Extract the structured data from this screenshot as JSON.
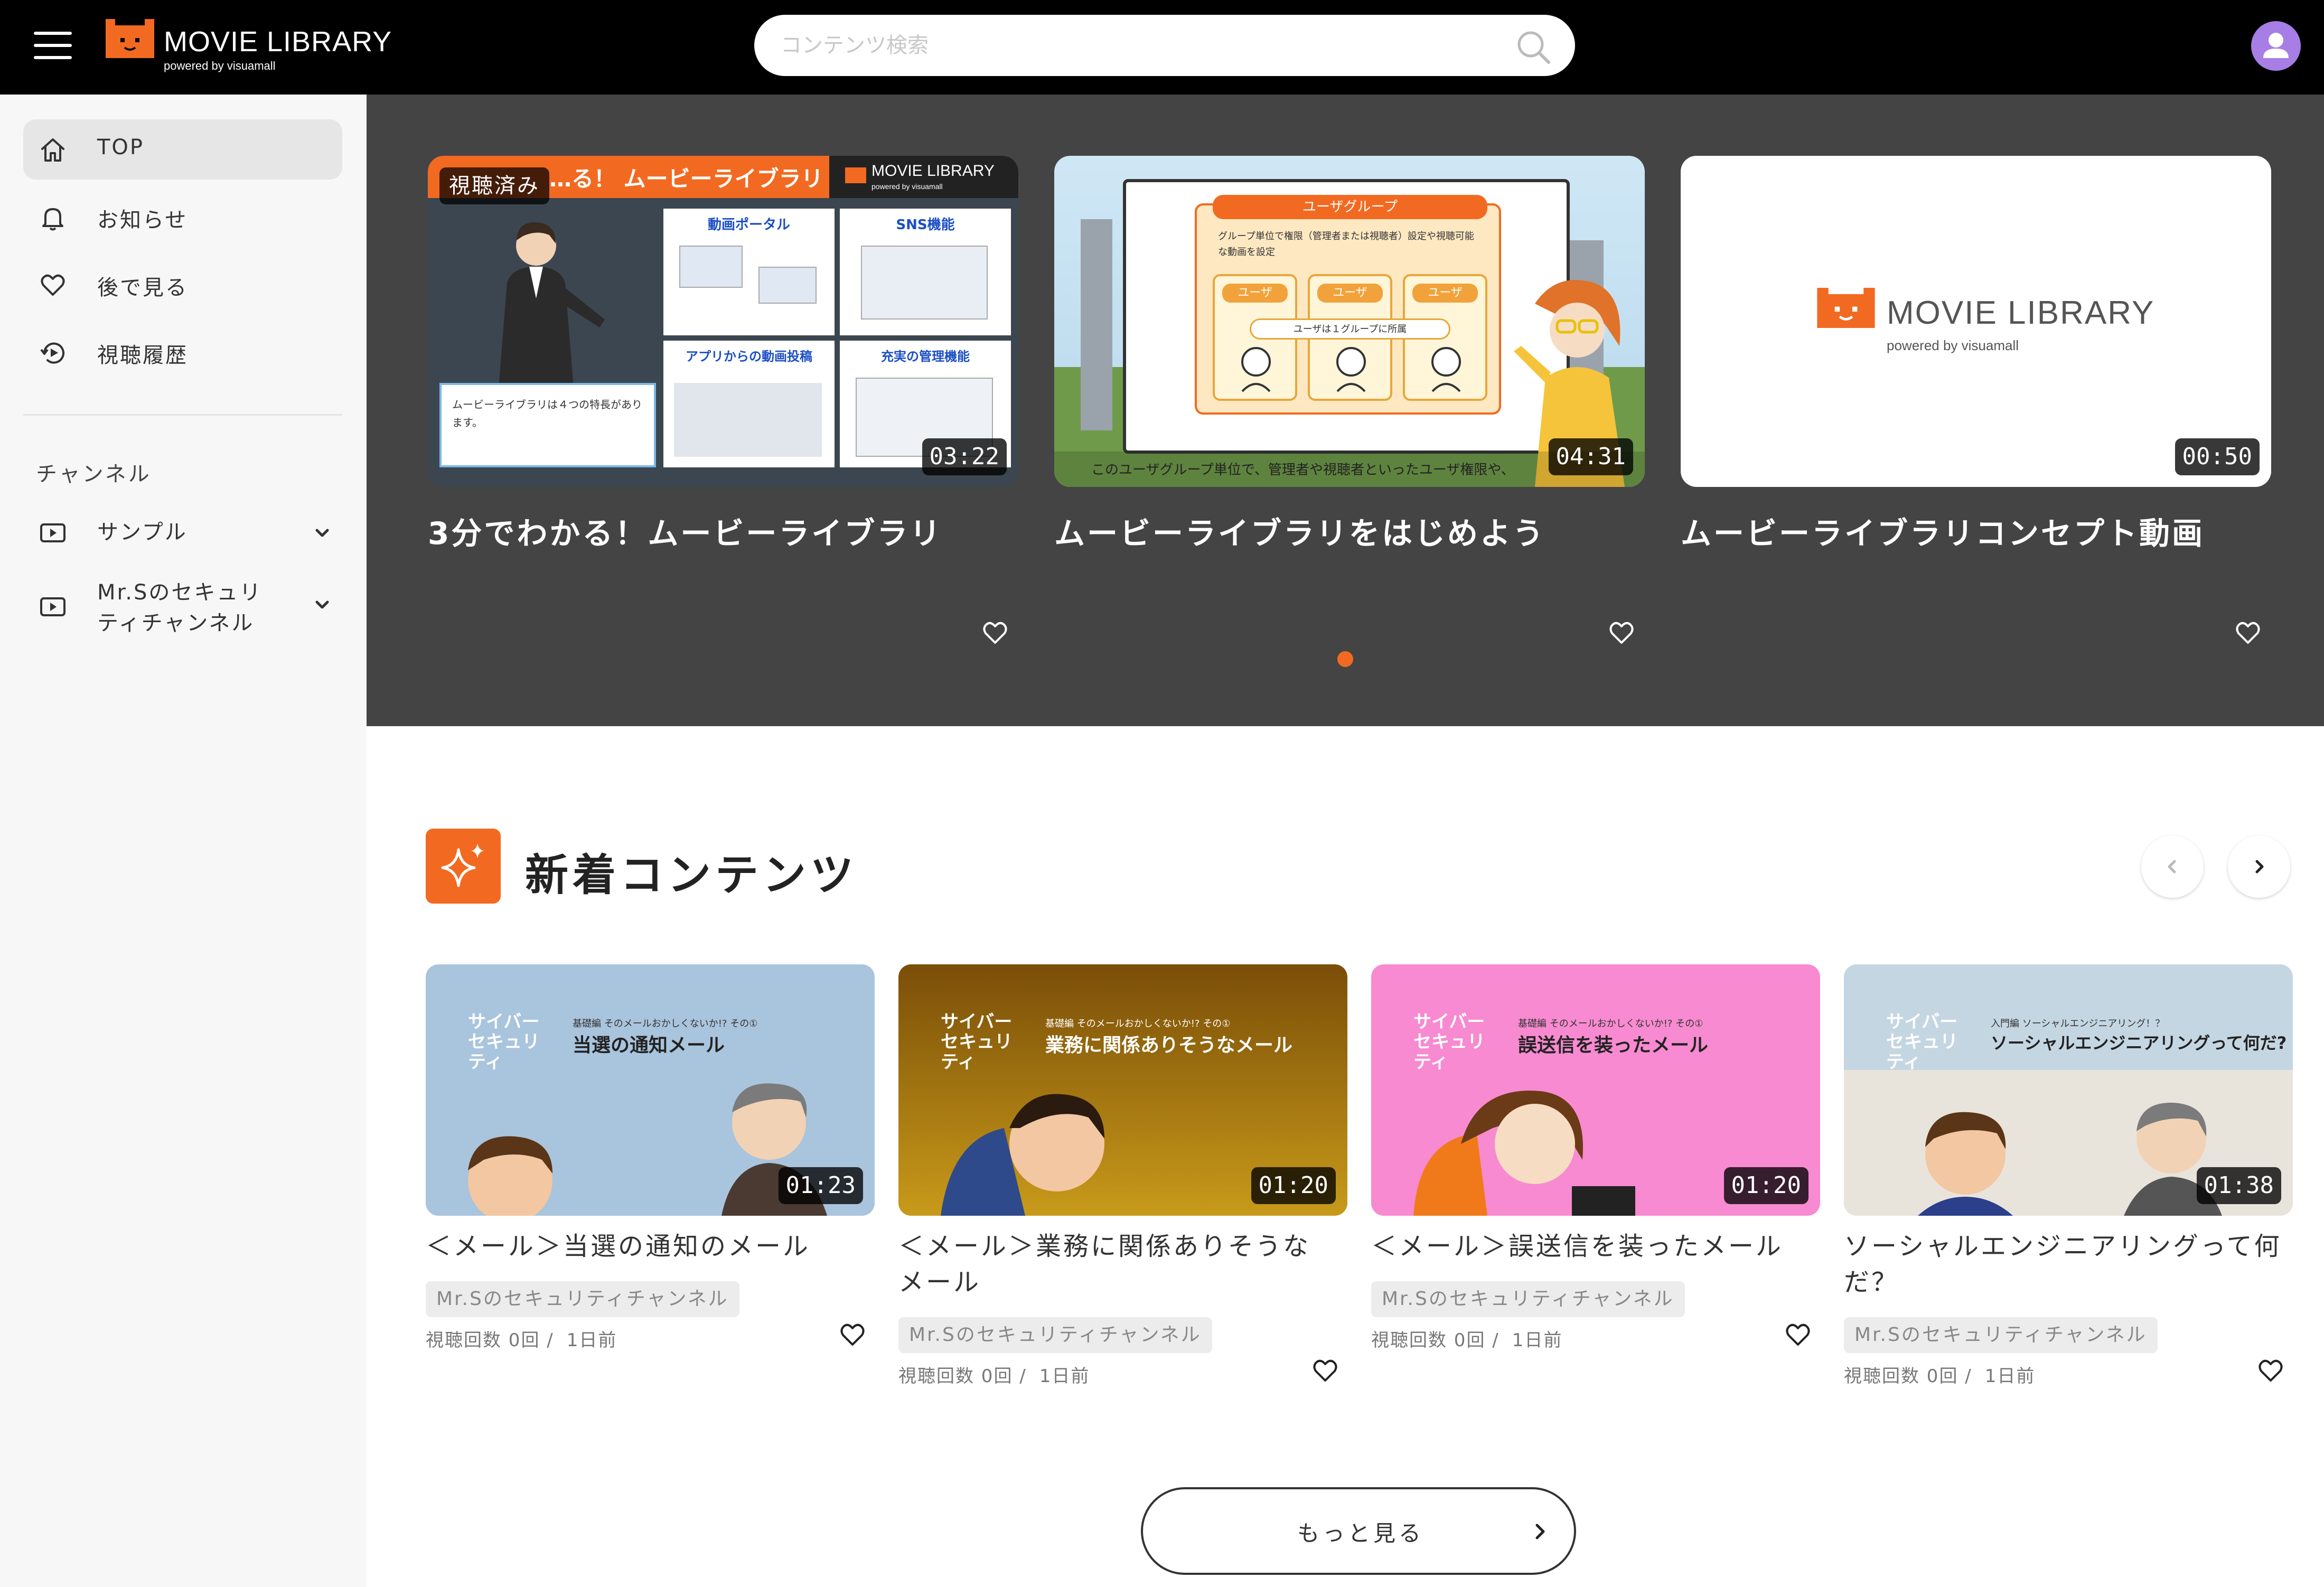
{
  "header": {
    "logo_title": "MOVIE LIBRARY",
    "logo_sub": "powered by visuamall",
    "search_placeholder": "コンテンツ検索"
  },
  "colors": {
    "accent": "#f26a21",
    "avatar": "#a77de6",
    "header_bg": "#000000",
    "hero_bg": "#444444"
  },
  "sidebar": {
    "nav": [
      {
        "label": "TOP",
        "icon": "home-icon",
        "active": true
      },
      {
        "label": "お知らせ",
        "icon": "bell-icon",
        "active": false
      },
      {
        "label": "後で見る",
        "icon": "heart-icon",
        "active": false
      },
      {
        "label": "視聴履歴",
        "icon": "history-icon",
        "active": false
      }
    ],
    "channels_title": "チャンネル",
    "channels": [
      {
        "label": "サンプル",
        "icon": "play-icon"
      },
      {
        "label": "Mr.Sのセキュリティチャンネル",
        "icon": "play-icon"
      }
    ]
  },
  "carousel": {
    "items": [
      {
        "title": "3分でわかる！ムービーライブラリ",
        "duration": "03:22",
        "badge": "視聴済み",
        "thumb_banner": "…る！ ムービーライブラリ",
        "thumb_logo": "MOVIE LIBRARY",
        "thumb_logo_sub": "powered by visuamall",
        "thumb_panels": [
          "動画ポータル",
          "SNS機能",
          "アプリからの動画投稿",
          "充実の管理機能"
        ],
        "thumb_caption": "ムービーライブラリは４つの特長があります。"
      },
      {
        "title": "ムービーライブラリをはじめよう",
        "duration": "04:31",
        "thumb_group": "ユーザグループ",
        "thumb_desc": "グループ単位で権限（管理者または視聴者）設定や視聴可能な動画を設定",
        "thumb_user": "ユーザ",
        "thumb_belong": "ユーザは１グループに所属",
        "thumb_caption": "このユーザグループ単位で、管理者や視聴者といったユーザ権限や、"
      },
      {
        "title": "ムービーライブラリコンセプト動画",
        "duration": "00:50",
        "thumb_logo": "MOVIE LIBRARY",
        "thumb_logo_sub": "powered by visuamall"
      }
    ]
  },
  "new_contents": {
    "heading": "新着コンテンツ",
    "items": [
      {
        "title": "＜メール＞当選の通知のメール",
        "duration": "01:23",
        "channel": "Mr.Sのセキュリティチャンネル",
        "views": "視聴回数 0回 /",
        "age": "1日前",
        "thumb_brand": "サイバー セキュリティ",
        "thumb_series": "基礎編 そのメールおかしくないか!? その①",
        "thumb_title": "当選の通知メール",
        "bg": "#a9c4dd"
      },
      {
        "title": "＜メール＞業務に関係ありそうなメール",
        "duration": "01:20",
        "channel": "Mr.Sのセキュリティチャンネル",
        "views": "視聴回数 0回 /",
        "age": "1日前",
        "thumb_brand": "サイバー セキュリティ",
        "thumb_series": "基礎編 そのメールおかしくないか!? その①",
        "thumb_title": "業務に関係ありそうなメール",
        "bg": "#9a6a10"
      },
      {
        "title": "＜メール＞誤送信を装ったメール",
        "duration": "01:20",
        "channel": "Mr.Sのセキュリティチャンネル",
        "views": "視聴回数 0回 /",
        "age": "1日前",
        "thumb_brand": "サイバー セキュリティ",
        "thumb_series": "基礎編 そのメールおかしくないか!? その①",
        "thumb_title": "誤送信を装ったメール",
        "bg": "#f78ad0"
      },
      {
        "title": "ソーシャルエンジニアリングって何だ？",
        "duration": "01:38",
        "channel": "Mr.Sのセキュリティチャンネル",
        "views": "視聴回数 0回 /",
        "age": "1日前",
        "thumb_brand": "サイバー セキュリティ",
        "thumb_series": "入門編 ソーシャルエンジニアリング！？",
        "thumb_title": "ソーシャルエンジニアリングって何だ?",
        "bg": "#c5d6e3"
      }
    ],
    "more_label": "もっと見る"
  }
}
